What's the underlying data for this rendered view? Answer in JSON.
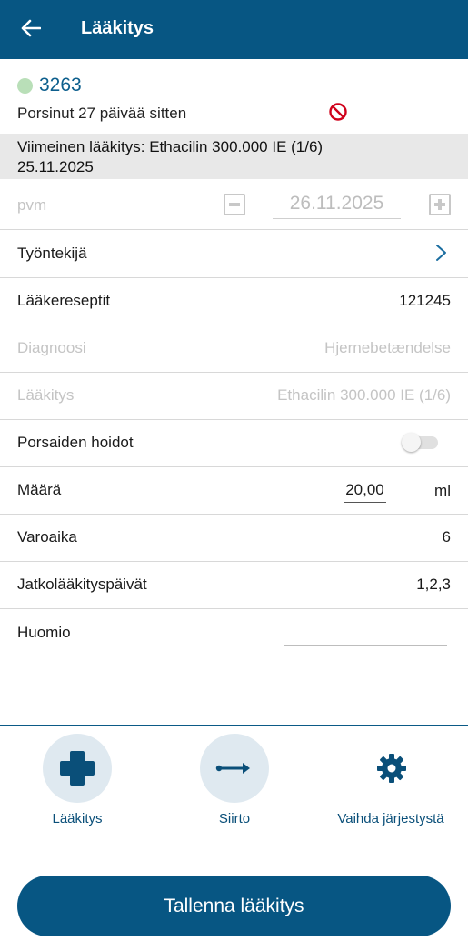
{
  "header": {
    "title": "Lääkitys",
    "back_icon": "arrow-left-icon"
  },
  "animal": {
    "id": "3263",
    "status_text": "Porsinut 27 päivää sitten",
    "status_dot_color": "#b9dfb8",
    "warning_icon": "no-entry-icon"
  },
  "last_medication": {
    "line1": "Viimeinen lääkitys: Ethacilin 300.000 IE (1/6)",
    "line2": "25.11.2025"
  },
  "form": {
    "date": {
      "label": "pvm",
      "value": "26.11.2025"
    },
    "worker": {
      "label": "Työntekijä"
    },
    "prescriptions": {
      "label": "Lääkereseptit",
      "value": "121245"
    },
    "diagnosis": {
      "label": "Diagnoosi",
      "value": "Hjernebetændelse"
    },
    "medication": {
      "label": "Lääkitys",
      "value": "Ethacilin 300.000 IE (1/6)"
    },
    "piglet_care": {
      "label": "Porsaiden hoidot",
      "enabled": false
    },
    "amount": {
      "label": "Määrä",
      "value": "20,00",
      "unit": "ml"
    },
    "withdrawal": {
      "label": "Varoaika",
      "value": "6"
    },
    "followup_days": {
      "label": "Jatkolääkityspäivät",
      "value": "1,2,3"
    },
    "note": {
      "label": "Huomio",
      "value": ""
    }
  },
  "actions": [
    {
      "label": "Lääkitys",
      "icon": "medical-cross-icon"
    },
    {
      "label": "Siirto",
      "icon": "arrow-right-icon"
    },
    {
      "label": "Vaihda järjestystä",
      "icon": "gear-icon"
    }
  ],
  "save_button": {
    "label": "Tallenna lääkitys"
  },
  "colors": {
    "primary": "#075683",
    "action_circle": "#dfe9f0"
  }
}
